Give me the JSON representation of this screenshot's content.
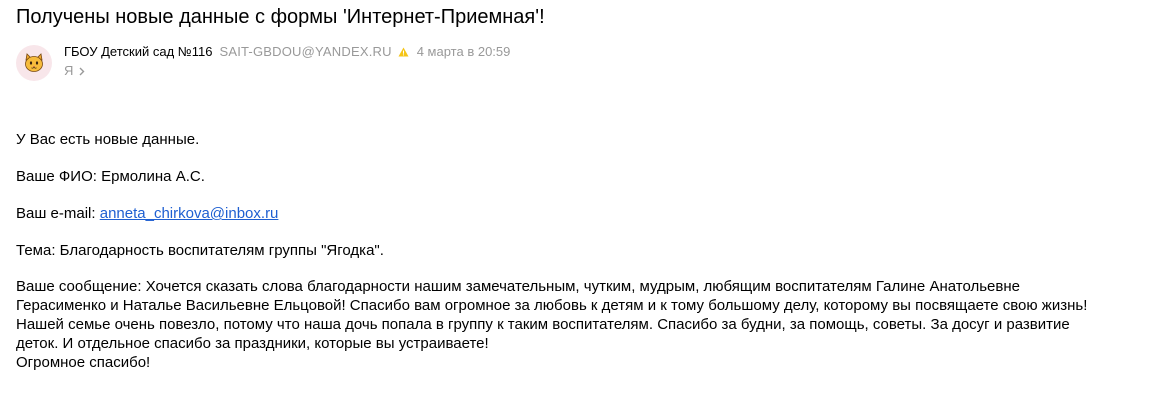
{
  "email": {
    "subject": "Получены новые данные с формы 'Интернет-Приемная'!",
    "sender": {
      "name": "ГБОУ Детский сад №116",
      "email": "SAIT-GBDOU@YANDEX.RU",
      "avatar_icon": "cat-face-icon",
      "avatar_bg": "#f8e6ea"
    },
    "date": "4 марта в 20:59",
    "recipient": "Я",
    "colors": {
      "link": "#1e5fd1",
      "muted": "#999999",
      "warning": "#f5c518"
    }
  },
  "body": {
    "intro": "У Вас есть новые данные.",
    "fio_label": "Ваше ФИО:",
    "fio_value": "Ермолина А.С.",
    "email_label": "Ваш e-mail:",
    "email_value": "anneta_chirkova@inbox.ru",
    "topic_label": "Тема:",
    "topic_value": "Благодарность воспитателям группы \"Ягодка\".",
    "message_lines": [
      "Ваше сообщение: Хочется сказать слова благодарности нашим замечательным, чутким, мудрым, любящим воспитателям Галине Анатольевне",
      "Герасименко и Наталье Васильевне Ельцовой! Спасибо вам огромное за любовь к детям и к тому большому делу, которому вы посвящаете свою жизнь!",
      "Нашей семье очень повезло, потому что наша дочь попала в группу к таким воспитателям. Спасибо за будни, за помощь, советы. За досуг и развитие",
      "деток. И отдельное спасибо за праздники, которые вы устраиваете!",
      "Огромное спасибо!"
    ]
  }
}
